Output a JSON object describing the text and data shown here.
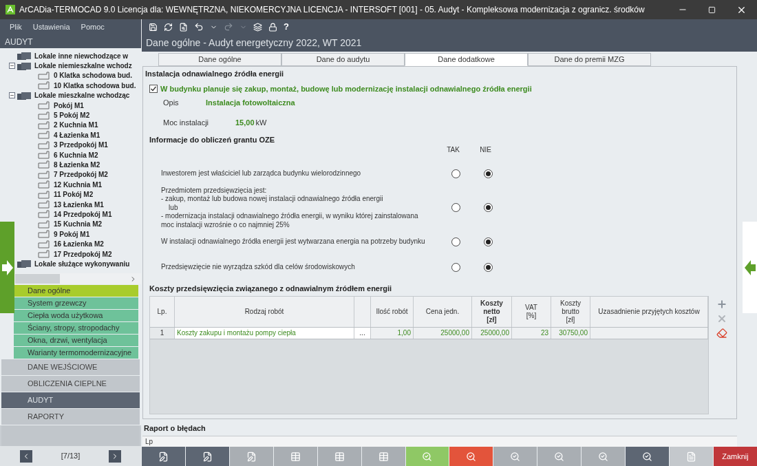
{
  "window": {
    "title": "ArCADia-TERMOCAD 9.0 Licencja dla: WEWNĘTRZNA, NIEKOMERCYJNA LICENCJA - INTERSOFT [001] - 05. Audyt - Kompleksowa modernizacja z ogranicz. środków"
  },
  "menu": [
    {
      "label": "Plik"
    },
    {
      "label": "Ustawienia"
    },
    {
      "label": "Pomoc"
    }
  ],
  "panel_title": "AUDYT",
  "tree": [
    {
      "label": "Lokale inne niewchodzące w",
      "kind": "folder"
    },
    {
      "label": "Lokale niemieszkalne wchodz",
      "kind": "folder",
      "expanded": true,
      "children": [
        {
          "label": "0 Klatka schodowa bud.",
          "kind": "room"
        },
        {
          "label": "10 Klatka schodowa bud.",
          "kind": "room"
        }
      ]
    },
    {
      "label": "Lokale mieszkalne wchodząc",
      "kind": "folder",
      "expanded": true,
      "children": [
        {
          "label": " Pokój M1",
          "kind": "room"
        },
        {
          "label": "5 Pokój M2",
          "kind": "room"
        },
        {
          "label": "2 Kuchnia M1",
          "kind": "room"
        },
        {
          "label": "4 Łazienka M1",
          "kind": "room"
        },
        {
          "label": "3 Przedpokój M1",
          "kind": "room"
        },
        {
          "label": "6 Kuchnia M2",
          "kind": "room"
        },
        {
          "label": "8 Łazienka M2",
          "kind": "room"
        },
        {
          "label": "7 Przedpokój M2",
          "kind": "room"
        },
        {
          "label": "12 Kuchnia M1",
          "kind": "room"
        },
        {
          "label": "11 Pokój M2",
          "kind": "room"
        },
        {
          "label": "13 Łazienka M1",
          "kind": "room"
        },
        {
          "label": "14 Przedpokój M1",
          "kind": "room"
        },
        {
          "label": "15 Kuchnia M2",
          "kind": "room"
        },
        {
          "label": "9 Pokój M1",
          "kind": "room"
        },
        {
          "label": "16 Łazienka M2",
          "kind": "room"
        },
        {
          "label": "17 Przedpokój M2",
          "kind": "room"
        }
      ]
    },
    {
      "label": "Lokale służące wykonywaniu",
      "kind": "folder"
    }
  ],
  "nav_items": [
    {
      "label": "Dane ogólne",
      "selected": true
    },
    {
      "label": "System grzewczy",
      "selected": false
    },
    {
      "label": "Ciepła woda użytkowa",
      "selected": false
    },
    {
      "label": "Ściany, stropy, stropodachy",
      "selected": false
    },
    {
      "label": "Okna, drzwi, wentylacja",
      "selected": false
    },
    {
      "label": "Warianty termomodernizacyjne",
      "selected": false
    }
  ],
  "sections": [
    {
      "label": "DANE WEJŚCIOWE",
      "selected": false
    },
    {
      "label": "OBLICZENIA CIEPLNE",
      "selected": false
    },
    {
      "label": "AUDYT",
      "selected": true
    },
    {
      "label": "RAPORTY",
      "selected": false
    }
  ],
  "pager": "[7/13]",
  "toolbar_help": "?",
  "page_title": "Dane ogólne - Audyt energetyczny 2022, WT 2021",
  "tabs": [
    {
      "label": "Dane ogólne",
      "selected": false
    },
    {
      "label": "Dane do audytu",
      "selected": false
    },
    {
      "label": "Dane dodatkowe",
      "selected": true
    },
    {
      "label": "Dane do premii MZG",
      "selected": false
    }
  ],
  "oze": {
    "heading": "Instalacja odnawialnego źródła energii",
    "plan": {
      "label": "W budynku planuje się zakup, montaż, budowę lub modernizację instalacji odnawialnego źródła energii",
      "checked": true
    },
    "opis_label": "Opis",
    "opis_value": "Instalacja fotowoltaiczna",
    "moc_label": "Moc instalacji",
    "moc_value": "15,00",
    "moc_unit": "kW"
  },
  "grant": {
    "heading": "Informacje do obliczeń grantu OZE",
    "columns": [
      "TAK",
      "NIE"
    ],
    "questions": [
      {
        "text": "Inwestorem jest właściciel lub zarządca budynku wielorodzinnego",
        "options": [
          {
            "selected": false
          },
          {
            "selected": true
          }
        ]
      },
      {
        "text": "Przedmiotem przedsięwzięcia jest:\n- zakup, montaż lub budowa nowej instalacji odnawialnego źródła energii\n    lub\n- modernizacja instalacji odnawialnego źródła energii, w wyniku której zainstalowana\nmoc instalacji wzrośnie o co najmniej 25%",
        "options": [
          {
            "selected": false
          },
          {
            "selected": true
          }
        ]
      },
      {
        "text": "W instalacji odnawialnego źródła energii jest wytwarzana energia na potrzeby budynku",
        "options": [
          {
            "selected": false
          },
          {
            "selected": true
          }
        ]
      },
      {
        "text": "Przedsięwzięcie nie wyrządza szkód dla celów środowiskowych",
        "options": [
          {
            "selected": false
          },
          {
            "selected": true
          }
        ]
      }
    ]
  },
  "costs": {
    "heading": "Koszty przedsięwzięcia związanego z odnawialnym źródłem energii",
    "columns": [
      {
        "label": "Lp."
      },
      {
        "label": "Rodzaj robót"
      },
      {
        "kind": "button"
      },
      {
        "label": "Ilość robót"
      },
      {
        "label": "Cena jedn."
      },
      {
        "label": "Koszty\nnetto\n[zł]",
        "bold": true
      },
      {
        "label": "VAT\n[%]"
      },
      {
        "label": "Koszty\nbrutto\n[zł]"
      },
      {
        "label": "Uzasadnienie przyjętych kosztów"
      }
    ],
    "rows": [
      {
        "cells": [
          "1",
          "Koszty zakupu i montażu pompy ciepła",
          "...",
          "1,00",
          "25000,00",
          "25000,00",
          "23",
          "30750,00"
        ]
      }
    ]
  },
  "errors": {
    "heading": "Raport o błędach",
    "column": "Lp"
  },
  "bottom_buttons": [
    {
      "kind": "doc",
      "color": "#5d6673"
    },
    {
      "kind": "doc",
      "color": "#5d6673"
    },
    {
      "kind": "doc",
      "color": "#a9aeb3"
    },
    {
      "kind": "table",
      "color": "#a9aeb3"
    },
    {
      "kind": "table",
      "color": "#a9aeb3"
    },
    {
      "kind": "table",
      "color": "#a9aeb3"
    },
    {
      "kind": "search",
      "color": "#8fc865"
    },
    {
      "kind": "search",
      "color": "#e3543b"
    },
    {
      "kind": "search",
      "color": "#a9aeb3"
    },
    {
      "kind": "search",
      "color": "#a9aeb3"
    },
    {
      "kind": "search",
      "color": "#a9aeb3"
    },
    {
      "kind": "search",
      "color": "#5d6673"
    },
    {
      "kind": "file",
      "color": "#c4c8cc"
    },
    {
      "kind": "close",
      "color": "#c0373a",
      "label": "Zamknij"
    }
  ]
}
